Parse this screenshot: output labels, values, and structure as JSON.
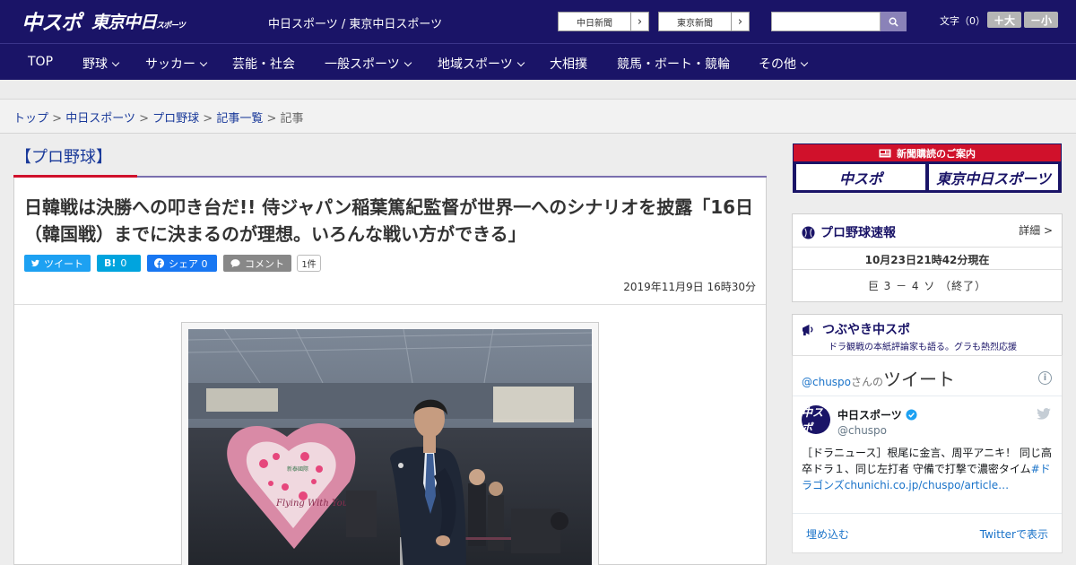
{
  "header": {
    "logo_main": "中スポ",
    "logo_tokyo": "東京中日",
    "logo_tokyo_small": "スポーツ",
    "site_name": "中日スポーツ / 東京中日スポーツ",
    "ext_links": [
      "中日新聞",
      "東京新聞"
    ],
    "font_label": "文字（0）",
    "font_plus": "＋大",
    "font_minus": "－小"
  },
  "nav": [
    {
      "label": "TOP",
      "has_menu": false
    },
    {
      "label": "野球",
      "has_menu": true
    },
    {
      "label": "サッカー",
      "has_menu": true
    },
    {
      "label": "芸能・社会",
      "has_menu": false
    },
    {
      "label": "一般スポーツ",
      "has_menu": true
    },
    {
      "label": "地域スポーツ",
      "has_menu": true
    },
    {
      "label": "大相撲",
      "has_menu": false
    },
    {
      "label": "競馬・ボート・競輪",
      "has_menu": false
    },
    {
      "label": "その他",
      "has_menu": true
    }
  ],
  "breadcrumb": {
    "items": [
      "トップ",
      "中日スポーツ",
      "プロ野球",
      "記事一覧"
    ],
    "sep": ">",
    "current": "記事"
  },
  "article": {
    "category": "【プロ野球】",
    "headline": "日韓戦は決勝への叩き台だ!! 侍ジャパン稲葉篤紀監督が世界一へのシナリオを披露「16日（韓国戦）までに決まるのが理想。いろんな戦い方ができる」",
    "share": {
      "tweet": "ツイート",
      "hatena": "0",
      "facebook": "シェア 0",
      "comment": "コメント",
      "comment_count": "1件"
    },
    "date": "2019年11月9日 16時30分",
    "photo_signs": [
      "Flying With You",
      "新泰國際"
    ]
  },
  "sidebar": {
    "subscribe": {
      "title": "新聞購読のご案内",
      "options": [
        "中スポ",
        "東京中日スポーツ"
      ]
    },
    "baseball": {
      "title": "プロ野球速報",
      "detail": "詳細 >",
      "timestamp": "10月23日21時42分現在",
      "score": "巨 3 － 4 ソ （終了）"
    },
    "tweets": {
      "title": "つぶやき中スポ",
      "subtitle": "ドラ観戦の本紙評論家も語る。グラも熱烈応援",
      "handle_prefix": "@chuspo",
      "handle_suffix": "さんの",
      "heading": "ツイート",
      "account_name": "中日スポーツ",
      "account_handle": "@chuspo",
      "tweet_text": "［ドラニュース］根尾に金言、周平アニキ！ 同じ高卒ドラ１、同じ左打者 守備で打撃で濃密タイム",
      "tweet_tag": "#ドラゴンズ",
      "tweet_link": "chunichi.co.jp/chuspo/article…",
      "embed": "埋め込む",
      "view_on_twitter": "Twitterで表示"
    }
  },
  "colors": {
    "navy": "#1a1467",
    "red": "#d0112b",
    "twitter": "#1da1f2",
    "facebook": "#1877f2",
    "hatena": "#00a4de"
  }
}
